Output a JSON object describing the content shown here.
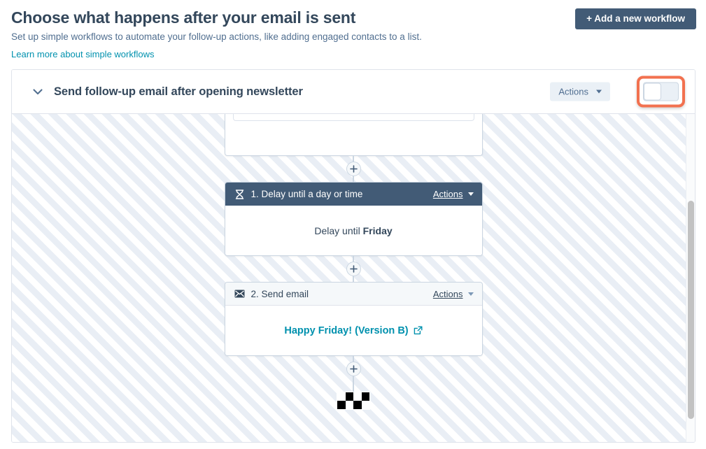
{
  "page": {
    "title": "Choose what happens after your email is sent",
    "subtitle": "Set up simple workflows to automate your follow-up actions, like adding engaged contacts to a list.",
    "learn_more_link": "Learn more about simple workflows",
    "add_workflow_button": "+ Add a new workflow",
    "accent_color": "#0091ae",
    "primary_button_color": "#425b76",
    "highlight_color": "#f2714f"
  },
  "workflow": {
    "name": "Send follow-up email after opening newsletter",
    "collapse_icon": "chevron-down-icon",
    "actions_button": "Actions",
    "toggle": {
      "name": "workflow-enabled-toggle",
      "state": "off",
      "highlighted": true
    }
  },
  "canvas": {
    "add_step_label": "+",
    "steps": [
      {
        "type": "partial",
        "header_style": "hidden"
      },
      {
        "type": "delay",
        "icon": "hourglass-icon",
        "title": "1. Delay until a day or time",
        "actions_label": "Actions",
        "header_style": "dark",
        "body_prefix": "Delay until ",
        "body_value": "Friday"
      },
      {
        "type": "email",
        "icon": "envelope-icon",
        "title": "2. Send email",
        "actions_label": "Actions",
        "header_style": "light",
        "body_link": "Happy Friday! (Version B)",
        "body_link_icon": "external-link-icon"
      }
    ],
    "end_marker": "checkered-flag-icon"
  }
}
